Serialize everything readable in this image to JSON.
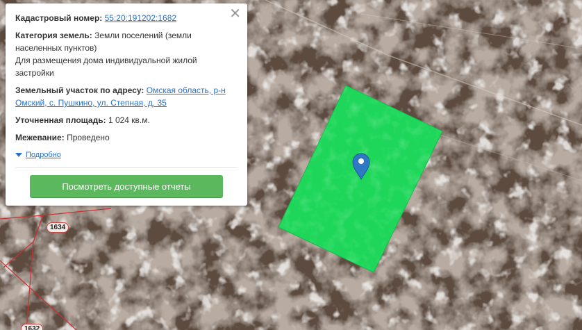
{
  "popup": {
    "close_glyph": "✕",
    "cadastral_label": "Кадастровый номер:",
    "cadastral_value": "55:20:191202:1682",
    "category_label": "Категория земель:",
    "category_value": "Земли поселений (земли населенных пунктов)",
    "category_use": "Для размещения дома индивидуальной жилой застройки",
    "address_label": "Земельный участок по адресу:",
    "address_value": "Омская область, р-н Омский, с. Пушкино, ул. Степная, д. 35",
    "area_label": "Уточненная площадь:",
    "area_value": "1 024 кв.м.",
    "survey_label": "Межевание:",
    "survey_value": "Проведено",
    "details_link": "Подробно",
    "reports_button": "Посмотреть доступные отчеты"
  },
  "map": {
    "parcel_labels": [
      "1634",
      "1632"
    ],
    "parcel_fill": "#1ed75a",
    "boundary_color": "#c83232",
    "marker_color": "#2f78c4"
  }
}
